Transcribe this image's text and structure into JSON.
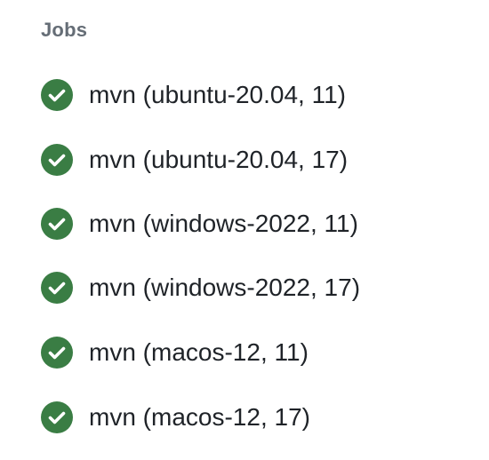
{
  "panel": {
    "heading": "Jobs"
  },
  "colors": {
    "success": "#3a7d44",
    "heading": "#656d76",
    "text": "#1f2328"
  },
  "jobs": [
    {
      "label": "mvn (ubuntu-20.04, 11)",
      "status": "success",
      "icon": "check-circle-icon"
    },
    {
      "label": "mvn (ubuntu-20.04, 17)",
      "status": "success",
      "icon": "check-circle-icon"
    },
    {
      "label": "mvn (windows-2022, 11)",
      "status": "success",
      "icon": "check-circle-icon"
    },
    {
      "label": "mvn (windows-2022, 17)",
      "status": "success",
      "icon": "check-circle-icon"
    },
    {
      "label": "mvn (macos-12, 11)",
      "status": "success",
      "icon": "check-circle-icon"
    },
    {
      "label": "mvn (macos-12, 17)",
      "status": "success",
      "icon": "check-circle-icon"
    }
  ]
}
